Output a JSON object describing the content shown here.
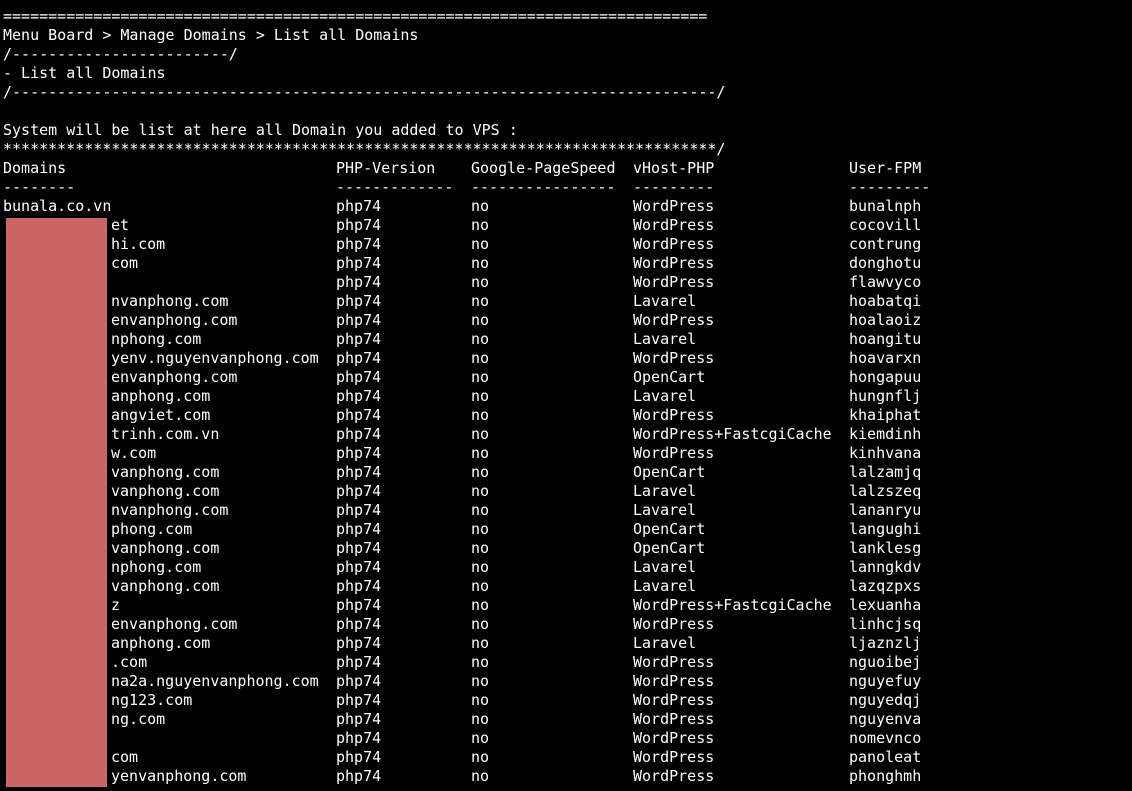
{
  "terminal": {
    "rule_top": "==============================================================================",
    "breadcrumb": "Menu Board > Manage Domains > List all Domains",
    "rule_short": "/------------------------/",
    "section_title": "- List all Domains",
    "rule_long": "/------------------------------------------------------------------------------/",
    "blank": "",
    "intro": "System will be list at here all Domain you added to VPS :",
    "rule_stars": "*******************************************************************************/"
  },
  "table": {
    "headers": {
      "domains": "Domains",
      "php_version": "PHP-Version",
      "google_pagespeed": "Google-PageSpeed",
      "vhost_php": "vHost-PHP",
      "user_fpm": "User-FPM"
    },
    "dashes": {
      "domains": "--------",
      "php_version": "-------------",
      "google_pagespeed": "----------------",
      "vhost_php": "---------",
      "user_fpm": "---------"
    },
    "rows": [
      {
        "domain": "bunala.co.vn",
        "php": "php74",
        "pagespeed": "no",
        "vhost": "WordPress",
        "user": "bunalnph"
      },
      {
        "domain": "et",
        "php": "php74",
        "pagespeed": "no",
        "vhost": "WordPress",
        "user": "cocovill"
      },
      {
        "domain": "hi.com",
        "php": "php74",
        "pagespeed": "no",
        "vhost": "WordPress",
        "user": "contrung"
      },
      {
        "domain": "com",
        "php": "php74",
        "pagespeed": "no",
        "vhost": "WordPress",
        "user": "donghotu"
      },
      {
        "domain": "",
        "php": "php74",
        "pagespeed": "no",
        "vhost": "WordPress",
        "user": "flawvyco"
      },
      {
        "domain": "nvanphong.com",
        "php": "php74",
        "pagespeed": "no",
        "vhost": "Lavarel",
        "user": "hoabatqi"
      },
      {
        "domain": "envanphong.com",
        "php": "php74",
        "pagespeed": "no",
        "vhost": "WordPress",
        "user": "hoalaoiz"
      },
      {
        "domain": "nphong.com",
        "php": "php74",
        "pagespeed": "no",
        "vhost": "Lavarel",
        "user": "hoangitu"
      },
      {
        "domain": "yenv.nguyenvanphong.com",
        "php": "php74",
        "pagespeed": "no",
        "vhost": "WordPress",
        "user": "hoavarxn"
      },
      {
        "domain": "envanphong.com",
        "php": "php74",
        "pagespeed": "no",
        "vhost": "OpenCart",
        "user": "hongapuu"
      },
      {
        "domain": "anphong.com",
        "php": "php74",
        "pagespeed": "no",
        "vhost": "Lavarel",
        "user": "hungnflj"
      },
      {
        "domain": "angviet.com",
        "php": "php74",
        "pagespeed": "no",
        "vhost": "WordPress",
        "user": "khaiphat"
      },
      {
        "domain": "trinh.com.vn",
        "php": "php74",
        "pagespeed": "no",
        "vhost": "WordPress+FastcgiCache",
        "user": "kiemdinh"
      },
      {
        "domain": "w.com",
        "php": "php74",
        "pagespeed": "no",
        "vhost": "WordPress",
        "user": "kinhvana"
      },
      {
        "domain": "vanphong.com",
        "php": "php74",
        "pagespeed": "no",
        "vhost": "OpenCart",
        "user": "lalzamjq"
      },
      {
        "domain": "vanphong.com",
        "php": "php74",
        "pagespeed": "no",
        "vhost": "Laravel",
        "user": "lalzszeq"
      },
      {
        "domain": "nvanphong.com",
        "php": "php74",
        "pagespeed": "no",
        "vhost": "Lavarel",
        "user": "lananryu"
      },
      {
        "domain": "phong.com",
        "php": "php74",
        "pagespeed": "no",
        "vhost": "OpenCart",
        "user": "langughi"
      },
      {
        "domain": "vanphong.com",
        "php": "php74",
        "pagespeed": "no",
        "vhost": "OpenCart",
        "user": "lanklesg"
      },
      {
        "domain": "nphong.com",
        "php": "php74",
        "pagespeed": "no",
        "vhost": "Lavarel",
        "user": "lanngkdv"
      },
      {
        "domain": "vanphong.com",
        "php": "php74",
        "pagespeed": "no",
        "vhost": "Lavarel",
        "user": "lazqzpxs"
      },
      {
        "domain": "z",
        "php": "php74",
        "pagespeed": "no",
        "vhost": "WordPress+FastcgiCache",
        "user": "lexuanha"
      },
      {
        "domain": "envanphong.com",
        "php": "php74",
        "pagespeed": "no",
        "vhost": "WordPress",
        "user": "linhcjsq"
      },
      {
        "domain": "anphong.com",
        "php": "php74",
        "pagespeed": "no",
        "vhost": "Laravel",
        "user": "ljaznzlj"
      },
      {
        "domain": ".com",
        "php": "php74",
        "pagespeed": "no",
        "vhost": "WordPress",
        "user": "nguoibej"
      },
      {
        "domain": "na2a.nguyenvanphong.com",
        "php": "php74",
        "pagespeed": "no",
        "vhost": "WordPress",
        "user": "nguyefuy"
      },
      {
        "domain": "ng123.com",
        "php": "php74",
        "pagespeed": "no",
        "vhost": "WordPress",
        "user": "nguyedqj"
      },
      {
        "domain": "ng.com",
        "php": "php74",
        "pagespeed": "no",
        "vhost": "WordPress",
        "user": "nguyenva"
      },
      {
        "domain": "",
        "php": "php74",
        "pagespeed": "no",
        "vhost": "WordPress",
        "user": "nomevnco"
      },
      {
        "domain": "com",
        "php": "php74",
        "pagespeed": "no",
        "vhost": "WordPress",
        "user": "panoleat"
      },
      {
        "domain": "yenvanphong.com",
        "php": "php74",
        "pagespeed": "no",
        "vhost": "WordPress",
        "user": "phonghmh"
      }
    ]
  },
  "colors": {
    "background": "#000000",
    "text": "#ffffff",
    "redaction": "#cc6666"
  }
}
